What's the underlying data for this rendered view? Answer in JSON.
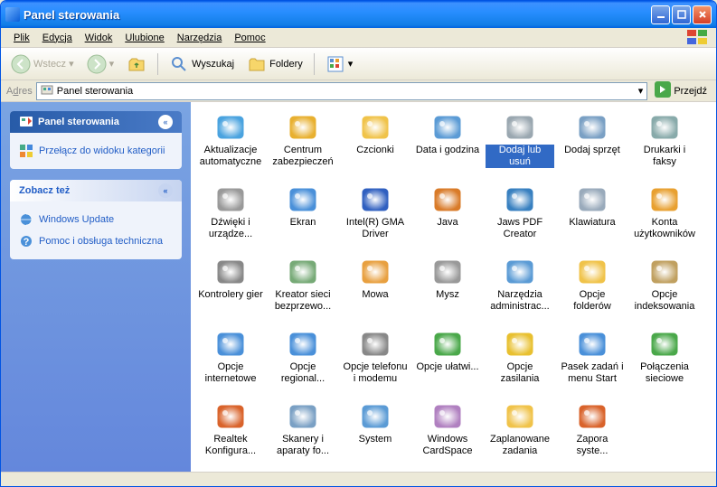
{
  "window": {
    "title": "Panel sterowania"
  },
  "menu": {
    "file": "Plik",
    "edit": "Edycja",
    "view": "Widok",
    "favorites": "Ulubione",
    "tools": "Narzędzia",
    "help": "Pomoc"
  },
  "toolbar": {
    "back": "Wstecz",
    "search": "Wyszukaj",
    "folders": "Foldery"
  },
  "address": {
    "label": "Adres",
    "value": "Panel sterowania",
    "go": "Przejdź"
  },
  "sidebar": {
    "panel1": {
      "title": "Panel sterowania",
      "link": "Przełącz do widoku kategorii"
    },
    "panel2": {
      "title": "Zobacz też",
      "links": [
        "Windows Update",
        "Pomoc i obsługa techniczna"
      ]
    }
  },
  "items": [
    {
      "label": "Aktualizacje automatyczne",
      "icon": "shield-update",
      "c": "#4aa3df"
    },
    {
      "label": "Centrum zabezpieczeń",
      "icon": "shield",
      "c": "#e8b030"
    },
    {
      "label": "Czcionki",
      "icon": "folder-font",
      "c": "#f0c34a"
    },
    {
      "label": "Data i godzina",
      "icon": "clock",
      "c": "#5b9bd5"
    },
    {
      "label": "Dodaj lub usuń programy",
      "icon": "box-cd",
      "c": "#9aa7b0",
      "selected": true
    },
    {
      "label": "Dodaj sprzęt",
      "icon": "hardware",
      "c": "#7aa0c4"
    },
    {
      "label": "Drukarki i faksy",
      "icon": "printer",
      "c": "#8aa"
    },
    {
      "label": "Dźwięki i urządze...",
      "icon": "speaker",
      "c": "#999"
    },
    {
      "label": "Ekran",
      "icon": "display",
      "c": "#4a90d9"
    },
    {
      "label": "Intel(R) GMA Driver",
      "icon": "chip",
      "c": "#3060c0"
    },
    {
      "label": "Java",
      "icon": "java",
      "c": "#d97b29"
    },
    {
      "label": "Jaws PDF Creator",
      "icon": "pdf",
      "c": "#3880c0"
    },
    {
      "label": "Klawiatura",
      "icon": "keyboard",
      "c": "#9ab"
    },
    {
      "label": "Konta użytkowników",
      "icon": "users",
      "c": "#e8a030"
    },
    {
      "label": "Kontrolery gier",
      "icon": "joystick",
      "c": "#888"
    },
    {
      "label": "Kreator sieci bezprzewo...",
      "icon": "wifi",
      "c": "#7a7"
    },
    {
      "label": "Mowa",
      "icon": "speech",
      "c": "#e8a040"
    },
    {
      "label": "Mysz",
      "icon": "mouse",
      "c": "#999"
    },
    {
      "label": "Narzędzia administrac...",
      "icon": "admin-tools",
      "c": "#5b9bd5"
    },
    {
      "label": "Opcje folderów",
      "icon": "folder-options",
      "c": "#f0c34a"
    },
    {
      "label": "Opcje indeksowania",
      "icon": "indexing",
      "c": "#c0a060"
    },
    {
      "label": "Opcje internetowe",
      "icon": "internet",
      "c": "#4a90d9"
    },
    {
      "label": "Opcje regional...",
      "icon": "regional",
      "c": "#4a90d9"
    },
    {
      "label": "Opcje telefonu i modemu",
      "icon": "phone-modem",
      "c": "#888"
    },
    {
      "label": "Opcje ułatwi...",
      "icon": "accessibility",
      "c": "#4aa84a"
    },
    {
      "label": "Opcje zasilania",
      "icon": "power",
      "c": "#e8c030"
    },
    {
      "label": "Pasek zadań i menu Start",
      "icon": "taskbar",
      "c": "#4a90d9"
    },
    {
      "label": "Połączenia sieciowe",
      "icon": "network",
      "c": "#4aa84a"
    },
    {
      "label": "Realtek Konfigura...",
      "icon": "audio",
      "c": "#d9632b"
    },
    {
      "label": "Skanery i aparaty fo...",
      "icon": "scanner",
      "c": "#7aa0c4"
    },
    {
      "label": "System",
      "icon": "system",
      "c": "#5b9bd5"
    },
    {
      "label": "Windows CardSpace",
      "icon": "cardspace",
      "c": "#b080c0"
    },
    {
      "label": "Zaplanowane zadania",
      "icon": "scheduled",
      "c": "#f0c34a"
    },
    {
      "label": "Zapora syste...",
      "icon": "firewall",
      "c": "#d9632b"
    }
  ]
}
